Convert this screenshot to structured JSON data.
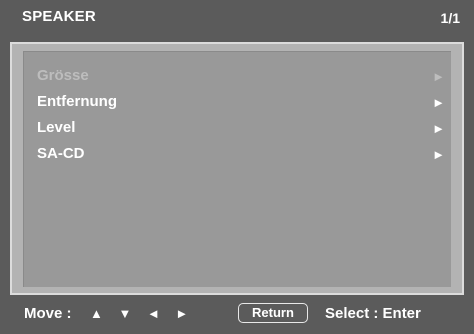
{
  "header": {
    "title": "SPEAKER",
    "page": "1/1"
  },
  "menu": {
    "items": [
      {
        "label": "Grösse",
        "arrow": "►",
        "enabled": false
      },
      {
        "label": "Entfernung",
        "arrow": "►",
        "enabled": true
      },
      {
        "label": "Level",
        "arrow": "►",
        "enabled": true
      },
      {
        "label": "SA-CD",
        "arrow": "►",
        "enabled": true
      }
    ]
  },
  "footer": {
    "move_label": "Move :",
    "move_arrows": "▲ ▼ ◄ ►",
    "return_label": "Return",
    "select_label": "Select :  Enter"
  },
  "colors": {
    "background": "#5b5b5b",
    "panel": "#999999",
    "panel_border": "#dcdcdc",
    "disabled_text": "#bdbdbd"
  }
}
